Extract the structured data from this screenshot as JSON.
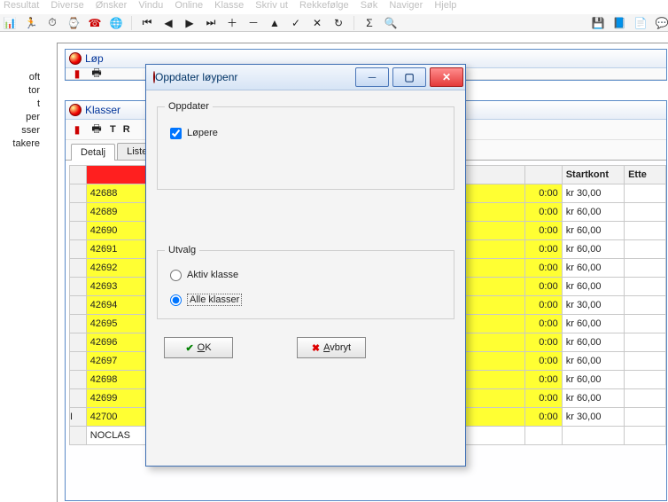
{
  "menu": [
    "Resultat",
    "Diverse",
    "Ønsker",
    "Vindu",
    "Online",
    "Klasse",
    "Skriv ut",
    "Rekkefølge",
    "Søk",
    "Naviger",
    "Hjelp"
  ],
  "left_tree": [
    "oft",
    "tor",
    "t",
    "per",
    "sser",
    "takere"
  ],
  "windows": {
    "lop_title": "Løp",
    "klasser_title": "Klasser",
    "klasser_tool_letters": [
      "T",
      "R"
    ],
    "tabs": {
      "detail": "Detalj",
      "list": "Liste"
    }
  },
  "table": {
    "headers": {
      "startkont": "Startkont",
      "ette": "Ette"
    },
    "rows": [
      {
        "code": "42688",
        "time": "0:00",
        "kont": "kr 30,00"
      },
      {
        "code": "42689",
        "time": "0:00",
        "kont": "kr 60,00"
      },
      {
        "code": "42690",
        "time": "0:00",
        "kont": "kr 60,00"
      },
      {
        "code": "42691",
        "time": "0:00",
        "kont": "kr 60,00"
      },
      {
        "code": "42692",
        "time": "0:00",
        "kont": "kr 60,00"
      },
      {
        "code": "42693",
        "time": "0:00",
        "kont": "kr 60,00"
      },
      {
        "code": "42694",
        "time": "0:00",
        "kont": "kr 30,00"
      },
      {
        "code": "42695",
        "time": "0:00",
        "kont": "kr 60,00"
      },
      {
        "code": "42696",
        "time": "0:00",
        "kont": "kr 60,00"
      },
      {
        "code": "42697",
        "time": "0:00",
        "kont": "kr 60,00"
      },
      {
        "code": "42698",
        "time": "0:00",
        "kont": "kr 60,00"
      },
      {
        "code": "42699",
        "time": "0:00",
        "kont": "kr 60,00"
      },
      {
        "code": "42700",
        "time": "0:00",
        "kont": "kr 30,00"
      },
      {
        "code": "NOCLAS",
        "time": "",
        "kont": ""
      }
    ]
  },
  "dialog": {
    "title": "Oppdater løypenr",
    "group_oppdater": "Oppdater",
    "check_lopere": "Løpere",
    "group_utvalg": "Utvalg",
    "radio_aktiv": "Aktiv klasse",
    "radio_alle": "Alle klasser",
    "ok_label": "OK",
    "ok_key": "O",
    "cancel_label": "Avbryt",
    "cancel_key": "A"
  }
}
